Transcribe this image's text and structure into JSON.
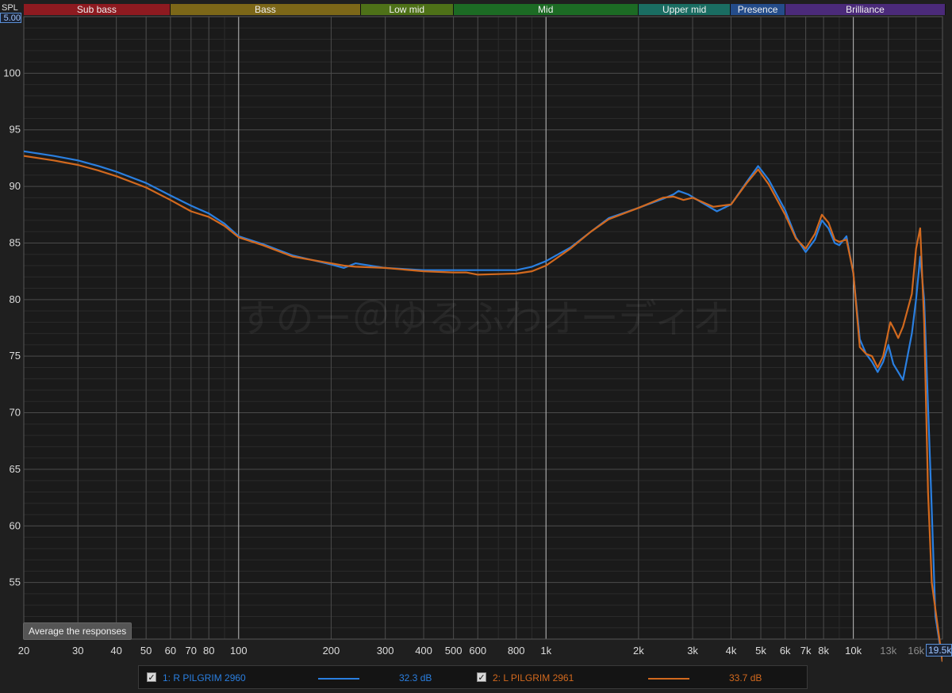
{
  "bands": [
    {
      "label": "Sub bass",
      "from": 20,
      "to": 60,
      "color": "#8e1a20"
    },
    {
      "label": "Bass",
      "from": 60,
      "to": 250,
      "color": "#7c6718"
    },
    {
      "label": "Low mid",
      "from": 250,
      "to": 500,
      "color": "#4e7118"
    },
    {
      "label": "Mid",
      "from": 500,
      "to": 2000,
      "color": "#1c6b24"
    },
    {
      "label": "Upper mid",
      "from": 2000,
      "to": 4000,
      "color": "#1a6d62"
    },
    {
      "label": "Presence",
      "from": 4000,
      "to": 6000,
      "color": "#244c8a"
    },
    {
      "label": "Brilliance",
      "from": 6000,
      "to": 20000,
      "color": "#4b2a7a"
    }
  ],
  "axis": {
    "spl_label": "SPL",
    "spl_max_value": "5.00",
    "freq_max_value": "19.5k"
  },
  "watermark": "すのー＠ゆるふわオーディオ",
  "average_button": "Average the responses",
  "legend": [
    {
      "index_label": "1: R PILGRIM 2960",
      "value": "32.3 dB",
      "color": "#2a7fe0",
      "checked": true
    },
    {
      "index_label": "2: L PILGRIM 2961",
      "value": "33.7 dB",
      "color": "#d2691e",
      "checked": true
    }
  ],
  "chart_data": {
    "type": "line",
    "x_scale": "log",
    "xlim": [
      20,
      19500
    ],
    "ylim": [
      50,
      105
    ],
    "xlabel": "",
    "ylabel": "SPL",
    "grid": true,
    "x_ticks": [
      {
        "v": 20,
        "label": "20"
      },
      {
        "v": 30,
        "label": "30"
      },
      {
        "v": 40,
        "label": "40"
      },
      {
        "v": 50,
        "label": "50"
      },
      {
        "v": 60,
        "label": "60"
      },
      {
        "v": 70,
        "label": "70"
      },
      {
        "v": 80,
        "label": "80"
      },
      {
        "v": 100,
        "label": "100"
      },
      {
        "v": 200,
        "label": "200"
      },
      {
        "v": 300,
        "label": "300"
      },
      {
        "v": 400,
        "label": "400"
      },
      {
        "v": 500,
        "label": "500"
      },
      {
        "v": 600,
        "label": "600"
      },
      {
        "v": 800,
        "label": "800"
      },
      {
        "v": 1000,
        "label": "1k"
      },
      {
        "v": 2000,
        "label": "2k"
      },
      {
        "v": 3000,
        "label": "3k"
      },
      {
        "v": 4000,
        "label": "4k"
      },
      {
        "v": 5000,
        "label": "5k"
      },
      {
        "v": 6000,
        "label": "6k"
      },
      {
        "v": 7000,
        "label": "7k"
      },
      {
        "v": 8000,
        "label": "8k"
      },
      {
        "v": 10000,
        "label": "10k"
      },
      {
        "v": 13000,
        "label": "13k"
      },
      {
        "v": 16000,
        "label": "16k"
      }
    ],
    "y_ticks": [
      55,
      60,
      65,
      70,
      75,
      80,
      85,
      90,
      95,
      100
    ],
    "series": [
      {
        "name": "1: R PILGRIM 2960",
        "color": "#2a7fe0",
        "points": [
          [
            20,
            93.1
          ],
          [
            25,
            92.7
          ],
          [
            30,
            92.3
          ],
          [
            35,
            91.8
          ],
          [
            40,
            91.3
          ],
          [
            50,
            90.3
          ],
          [
            60,
            89.2
          ],
          [
            70,
            88.3
          ],
          [
            80,
            87.6
          ],
          [
            90,
            86.7
          ],
          [
            100,
            85.6
          ],
          [
            120,
            84.9
          ],
          [
            150,
            83.9
          ],
          [
            200,
            83.1
          ],
          [
            220,
            82.8
          ],
          [
            240,
            83.2
          ],
          [
            300,
            82.8
          ],
          [
            400,
            82.6
          ],
          [
            500,
            82.6
          ],
          [
            600,
            82.6
          ],
          [
            800,
            82.6
          ],
          [
            900,
            82.9
          ],
          [
            1000,
            83.4
          ],
          [
            1200,
            84.6
          ],
          [
            1400,
            86.0
          ],
          [
            1600,
            87.2
          ],
          [
            2000,
            88.1
          ],
          [
            2400,
            88.9
          ],
          [
            2600,
            89.3
          ],
          [
            2700,
            89.6
          ],
          [
            2900,
            89.3
          ],
          [
            3200,
            88.6
          ],
          [
            3600,
            87.8
          ],
          [
            4000,
            88.4
          ],
          [
            4500,
            90.4
          ],
          [
            4900,
            91.8
          ],
          [
            5300,
            90.6
          ],
          [
            6000,
            87.9
          ],
          [
            6500,
            85.5
          ],
          [
            7000,
            84.2
          ],
          [
            7500,
            85.3
          ],
          [
            7900,
            87.0
          ],
          [
            8300,
            86.3
          ],
          [
            8700,
            85.0
          ],
          [
            9000,
            84.8
          ],
          [
            9500,
            85.6
          ],
          [
            10000,
            82.3
          ],
          [
            10500,
            76.5
          ],
          [
            11000,
            75.2
          ],
          [
            11500,
            74.5
          ],
          [
            12000,
            73.6
          ],
          [
            12500,
            74.5
          ],
          [
            13000,
            76.0
          ],
          [
            13500,
            74.3
          ],
          [
            14500,
            72.9
          ],
          [
            15500,
            77.0
          ],
          [
            16000,
            80.0
          ],
          [
            16500,
            83.8
          ],
          [
            17000,
            80.0
          ],
          [
            17800,
            65.0
          ],
          [
            18500,
            52.0
          ],
          [
            19500,
            48.0
          ]
        ]
      },
      {
        "name": "2: L PILGRIM 2961",
        "color": "#d2691e",
        "points": [
          [
            20,
            92.7
          ],
          [
            25,
            92.3
          ],
          [
            30,
            91.9
          ],
          [
            35,
            91.4
          ],
          [
            40,
            90.9
          ],
          [
            50,
            89.9
          ],
          [
            60,
            88.8
          ],
          [
            70,
            87.8
          ],
          [
            80,
            87.3
          ],
          [
            90,
            86.5
          ],
          [
            100,
            85.5
          ],
          [
            120,
            84.8
          ],
          [
            150,
            83.8
          ],
          [
            200,
            83.2
          ],
          [
            220,
            83.0
          ],
          [
            240,
            82.9
          ],
          [
            300,
            82.8
          ],
          [
            400,
            82.5
          ],
          [
            500,
            82.4
          ],
          [
            550,
            82.4
          ],
          [
            600,
            82.2
          ],
          [
            800,
            82.3
          ],
          [
            900,
            82.5
          ],
          [
            1000,
            83.0
          ],
          [
            1200,
            84.5
          ],
          [
            1400,
            86.0
          ],
          [
            1600,
            87.1
          ],
          [
            2000,
            88.1
          ],
          [
            2400,
            89.0
          ],
          [
            2600,
            89.1
          ],
          [
            2800,
            88.8
          ],
          [
            3000,
            89.0
          ],
          [
            3500,
            88.2
          ],
          [
            4000,
            88.4
          ],
          [
            4500,
            90.3
          ],
          [
            4900,
            91.5
          ],
          [
            5300,
            90.2
          ],
          [
            6000,
            87.5
          ],
          [
            6500,
            85.4
          ],
          [
            7000,
            84.5
          ],
          [
            7500,
            85.8
          ],
          [
            7900,
            87.5
          ],
          [
            8300,
            86.8
          ],
          [
            8700,
            85.3
          ],
          [
            9000,
            85.1
          ],
          [
            9500,
            85.3
          ],
          [
            10000,
            82.4
          ],
          [
            10500,
            75.8
          ],
          [
            11000,
            75.2
          ],
          [
            11500,
            75.0
          ],
          [
            12000,
            74.0
          ],
          [
            12500,
            75.0
          ],
          [
            13000,
            77.2
          ],
          [
            13200,
            78.0
          ],
          [
            13500,
            77.5
          ],
          [
            14000,
            76.6
          ],
          [
            14500,
            77.6
          ],
          [
            15500,
            80.5
          ],
          [
            16000,
            84.5
          ],
          [
            16500,
            86.3
          ],
          [
            17000,
            78.0
          ],
          [
            17500,
            63.0
          ],
          [
            18000,
            55.0
          ],
          [
            19500,
            48.0
          ]
        ]
      }
    ]
  }
}
